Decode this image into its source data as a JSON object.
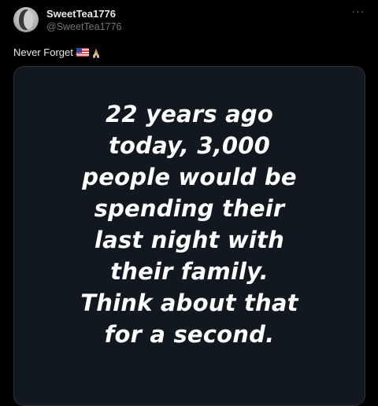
{
  "post": {
    "author": {
      "display_name": "SweetTea1776",
      "handle": "@SweetTea1776",
      "avatar_icon": "profile-photo"
    },
    "more_icon": "more-options-icon",
    "text": "Never Forget",
    "emojis": [
      "us-flag",
      "folded-hands"
    ],
    "media": {
      "background": "#121820",
      "text_color": "#ffffff",
      "lines": [
        "22 years ago",
        "today, 3,000",
        "people would be",
        "spending their",
        "last night with",
        "their family.",
        "Think about that",
        "for a second."
      ]
    }
  }
}
